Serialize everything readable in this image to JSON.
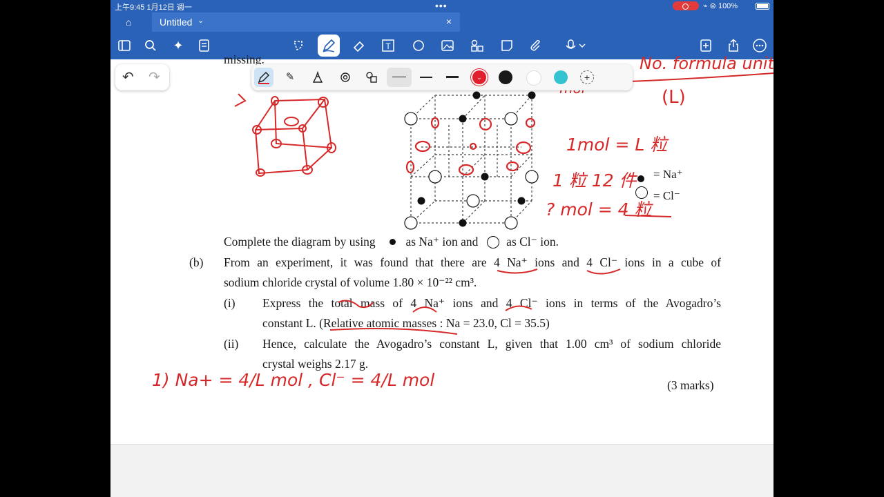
{
  "status": {
    "time": "上午9:45   1月12日 週一",
    "right": "⌁ ⊜ 100%"
  },
  "tab": {
    "title": "Untitled",
    "chevron": "⌄",
    "close": "×"
  },
  "toolbar_icons": [
    "sidebar-icon",
    "search-icon",
    "sparkle-icon",
    "note-icon",
    "lasso-icon",
    "pen-icon",
    "eraser-icon",
    "textbox-icon",
    "shape-icon",
    "image-icon",
    "shapes-icon",
    "sticky-note-icon",
    "attach-icon",
    "microphone-icon",
    "add-page-icon",
    "share-icon",
    "more-icon"
  ],
  "pen_colors": {
    "red": "#e0202c",
    "black": "#1a1a1a",
    "white": "#ffffff",
    "teal": "#35c3d2"
  },
  "doc": {
    "partial_top": "missing.",
    "complete_line": {
      "pre": "Complete the diagram by using",
      "na": "as Na⁺ ion and",
      "cl": "as Cl⁻ ion."
    },
    "b_label": "(b)",
    "b_line1": "From an experiment, it was found that there are 4 Na⁺ ions and 4 Cl⁻ ions in a cube of",
    "b_line2": "sodium chloride crystal of volume 1.80 × 10⁻²² cm³.",
    "i_label": "(i)",
    "i_line1": "Express the total mass of 4 Na⁺ ions and 4 Cl⁻ ions in terms of the Avogadro’s",
    "i_line2": "constant L. (Relative atomic masses : Na = 23.0, Cl = 35.5)",
    "ii_label": "(ii)",
    "ii_line1": "Hence, calculate the Avogadro’s constant L, given that 1.00 cm³ of sodium chloride",
    "ii_line2": "crystal weighs 2.17 g.",
    "marks": "(3 marks)",
    "legend_na": "= Na⁺",
    "legend_cl": "= Cl⁻"
  },
  "handwriting": {
    "top_right": "No. formula unit",
    "paren_L": "(L)",
    "l1": "1mol = L 粒",
    "l2": "1 粒 12 件",
    "l3": "? mol = 4 粒",
    "answer": "1)  Na+  =  4/L mol ,  Cl⁻  =  4/L mol",
    "small_top": "mol"
  }
}
